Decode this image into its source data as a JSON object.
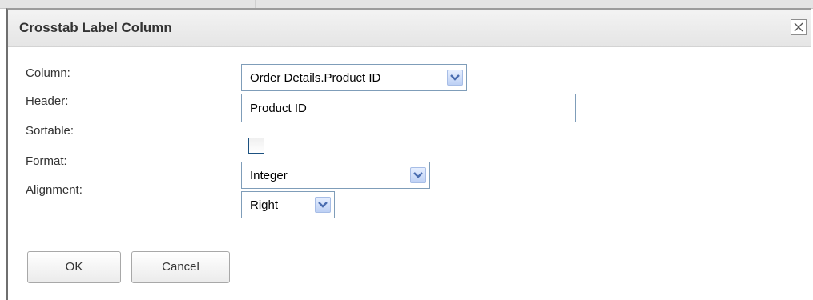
{
  "dialog": {
    "title": "Crosstab Label Column",
    "close_icon": "close-icon"
  },
  "form": {
    "column": {
      "label": "Column:",
      "value": "Order Details.Product ID"
    },
    "header": {
      "label": "Header:",
      "value": "Product ID"
    },
    "sortable": {
      "label": "Sortable:",
      "checked": false
    },
    "format": {
      "label": "Format:",
      "value": "Integer"
    },
    "alignment": {
      "label": "Alignment:",
      "value": "Right"
    }
  },
  "buttons": {
    "ok_label": "OK",
    "cancel_label": "Cancel"
  },
  "colors": {
    "titlebar": "#e9e9e9",
    "input_border": "#7f9db9",
    "dropdown_arrow": "#4a6db0"
  }
}
